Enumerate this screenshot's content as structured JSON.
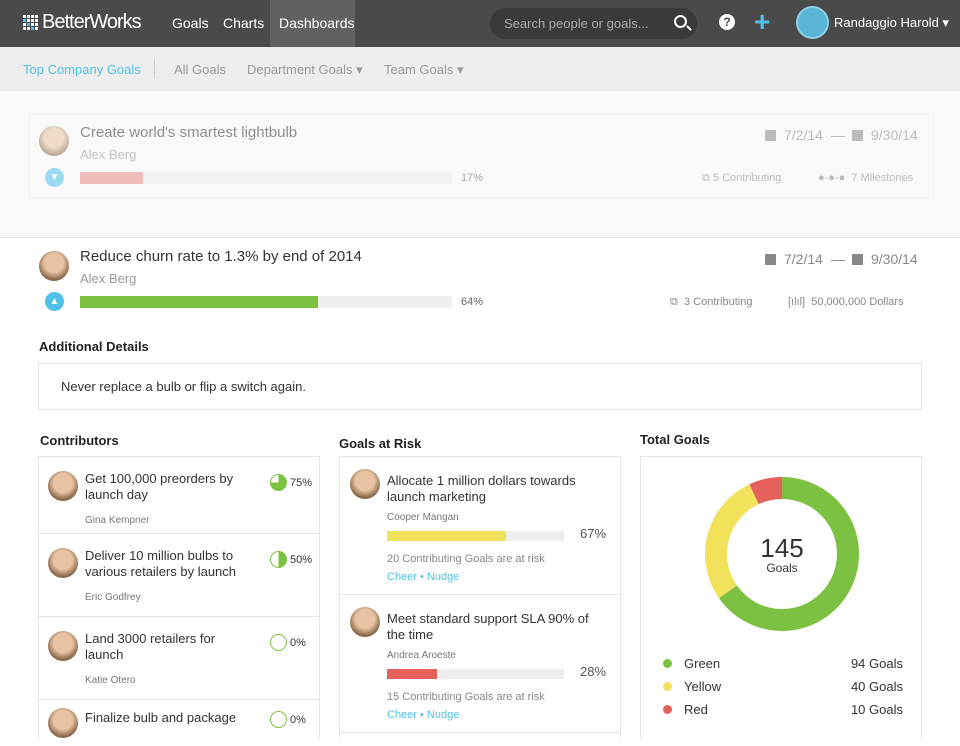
{
  "nav": {
    "brand": "BetterWorks",
    "links": [
      "Goals",
      "Charts",
      "Dashboards"
    ],
    "search_placeholder": "Search people or goals...",
    "help": "?",
    "add": "+",
    "user": "Randaggio Harold ▾"
  },
  "subnav": {
    "items": [
      "Top Company Goals",
      "All Goals",
      "Department Goals ▾",
      "Team Goals ▾"
    ]
  },
  "goals": [
    {
      "title": "Create world's smartest lightbulb",
      "owner": "Alex Berg",
      "progress": 17,
      "progress_label": "17%",
      "start": "7/2/14",
      "end": "9/30/14",
      "contributing": "5 Contributing",
      "extra": "7 Milestones",
      "color": "#e88a8a"
    },
    {
      "title": "Reduce churn rate to 1.3% by end of 2014",
      "owner": "Alex Berg",
      "progress": 64,
      "progress_label": "64%",
      "start": "7/2/14",
      "end": "9/30/14",
      "contributing": "3 Contributing",
      "extra": "50,000,000 Dollars",
      "color": "#7dc142"
    }
  ],
  "details": {
    "heading": "Additional Details",
    "text": "Never replace a bulb or flip a switch again."
  },
  "contributors": {
    "heading": "Contributors",
    "items": [
      {
        "title": "Get 100,000 preorders by launch day",
        "owner": "Gina Kempner",
        "progress": 75,
        "label": "75%"
      },
      {
        "title": "Deliver 10 million bulbs to various retailers by launch",
        "owner": "Eric Godfrey",
        "progress": 50,
        "label": "50%"
      },
      {
        "title": "Land 3000 retailers for launch",
        "owner": "Katie Otero",
        "progress": 0,
        "label": "0%"
      },
      {
        "title": "Finalize bulb and package",
        "owner": "",
        "progress": 0,
        "label": "0%"
      }
    ]
  },
  "risk": {
    "heading": "Goals at Risk",
    "items": [
      {
        "title": "Allocate 1 million dollars towards launch marketing",
        "owner": "Cooper Mangan",
        "progress": 67,
        "label": "67%",
        "color": "#f2e15a",
        "risk": "20 Contributing Goals are at risk",
        "links": "Cheer • Nudge"
      },
      {
        "title": "Meet standard support SLA 90% of the time",
        "owner": "Andrea Aroeste",
        "progress": 28,
        "label": "28%",
        "color": "#e5605a",
        "risk": "15 Contributing Goals are at risk",
        "links": "Cheer • Nudge"
      }
    ]
  },
  "total": {
    "heading": "Total Goals",
    "count": "145",
    "unit": "Goals",
    "legend": [
      {
        "name": "Green",
        "value": 94,
        "label": "94 Goals",
        "color": "#7dc142"
      },
      {
        "name": "Yellow",
        "value": 40,
        "label": "40 Goals",
        "color": "#f2e15a"
      },
      {
        "name": "Red",
        "value": 10,
        "label": "10 Goals",
        "color": "#e5605a"
      }
    ]
  }
}
